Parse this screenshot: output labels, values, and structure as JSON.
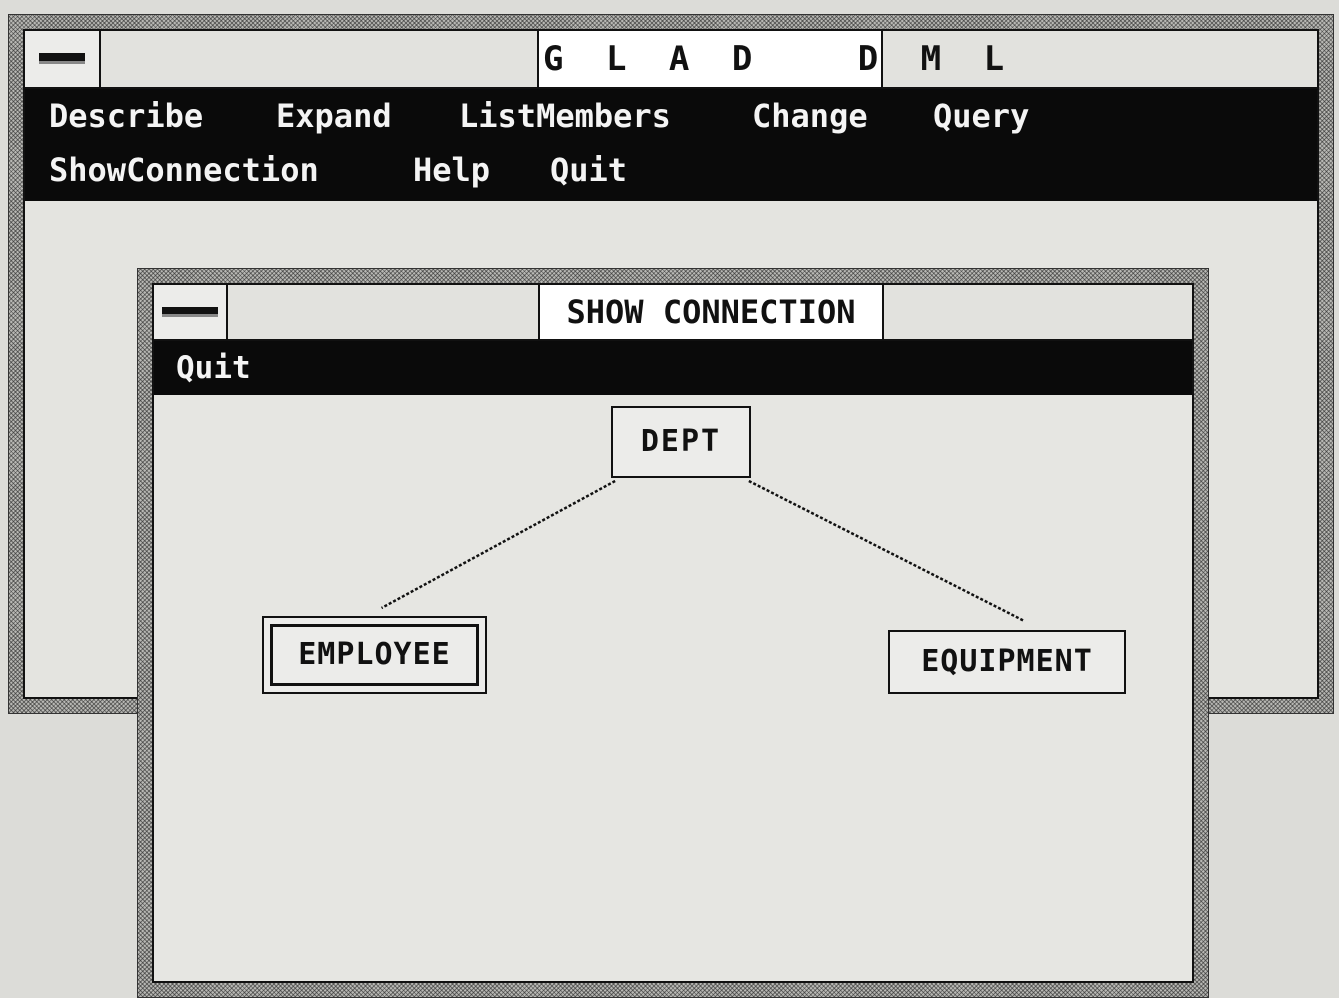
{
  "main_window": {
    "title": "G L A D   D M L",
    "menu_row_1": [
      "Describe",
      "Expand",
      "ListMembers",
      "Change",
      "Query"
    ],
    "menu_row_2": [
      "ShowConnection",
      "Help",
      "Quit"
    ]
  },
  "dialog": {
    "title": "SHOW CONNECTION",
    "menu": [
      "Quit"
    ],
    "nodes": {
      "dept": "DEPT",
      "employee": "EMPLOYEE",
      "equipment": "EQUIPMENT"
    }
  },
  "colors": {
    "menu_bar": "#0a0a0a",
    "menu_text": "#f4f4f4",
    "window_bg": "#e4e4e0",
    "frame": "#b8b8b4"
  },
  "icons": {
    "system_menu": "system-menu-bar-icon"
  }
}
